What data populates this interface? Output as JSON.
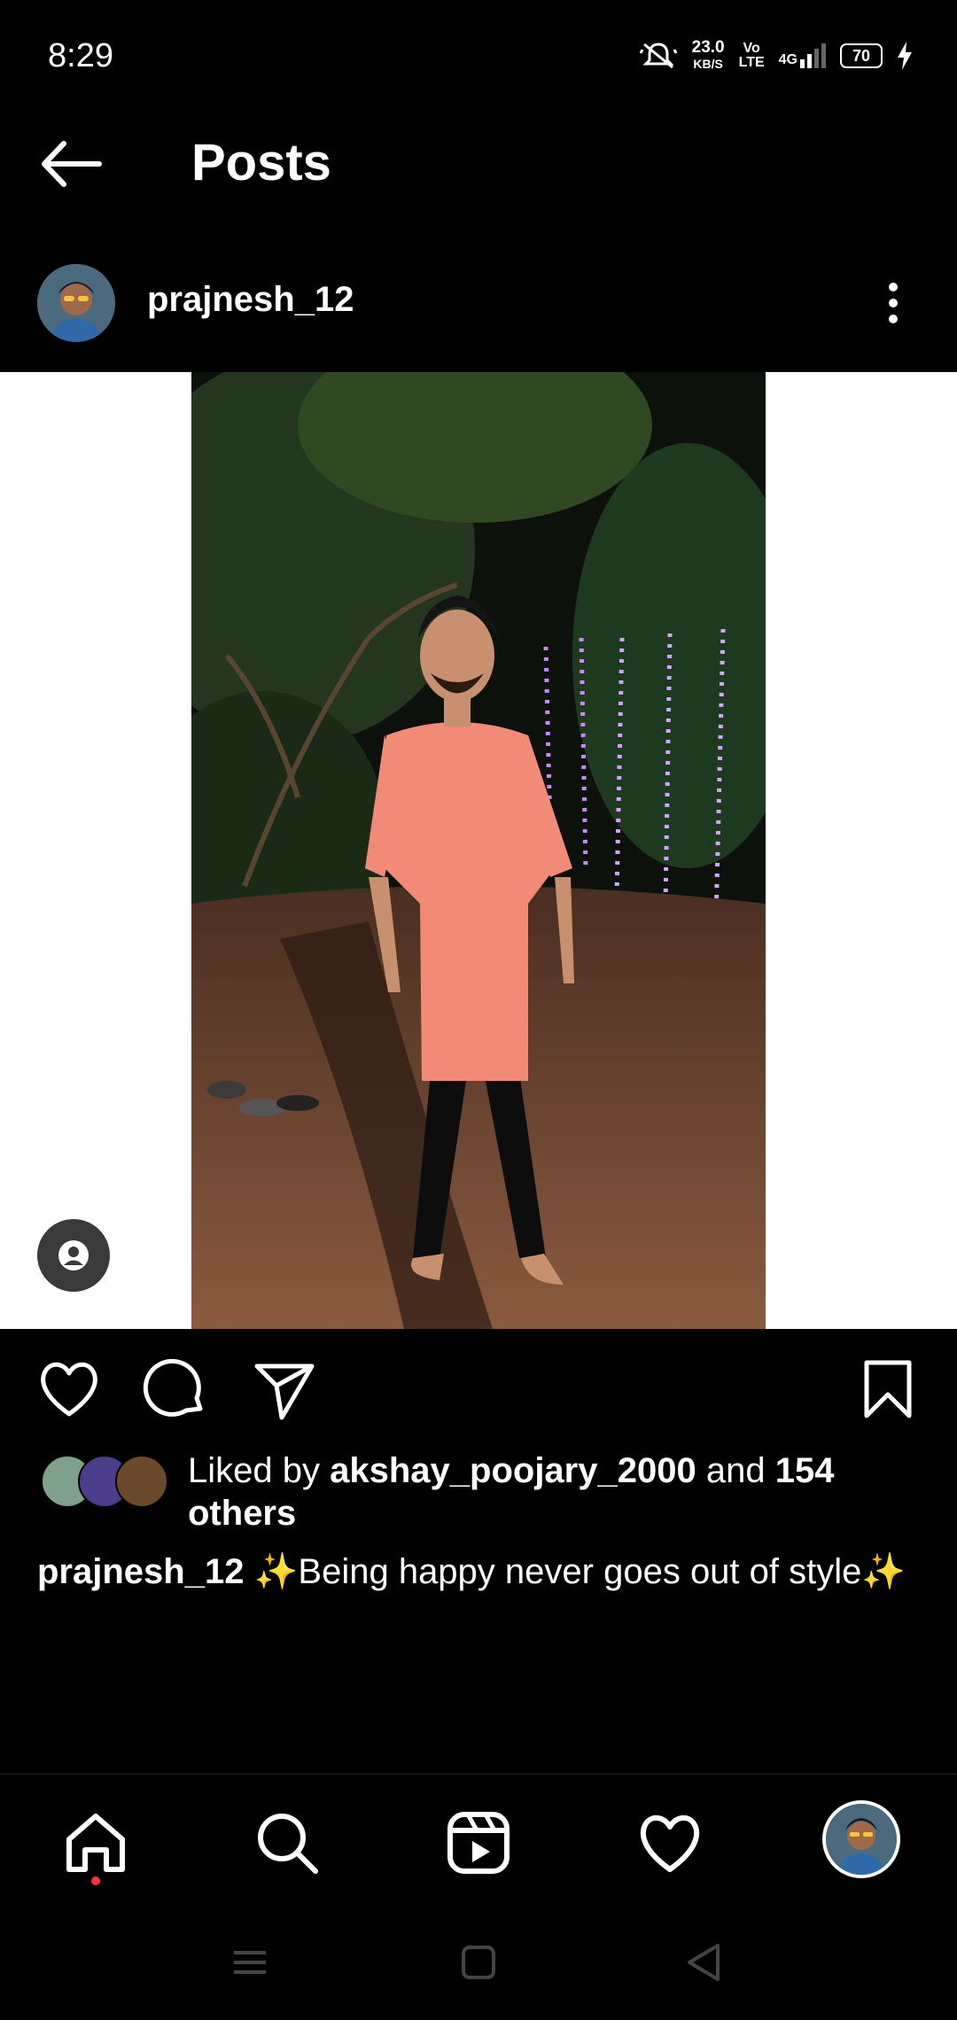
{
  "status_bar": {
    "time": "8:29",
    "net_speed_value": "23.0",
    "net_speed_unit": "KB/S",
    "volte_top": "Vo",
    "volte_bottom": "LTE",
    "network": "4G",
    "battery": "70"
  },
  "header": {
    "title": "Posts"
  },
  "post": {
    "username": "prajnesh_12",
    "likes": {
      "prefix": "Liked by ",
      "user": "akshay_poojary_2000",
      "middle": " and ",
      "count": "154",
      "suffix": "others"
    },
    "caption": {
      "user": "prajnesh_12",
      "text": "✨Being happy never goes out of style✨"
    }
  },
  "icons": {
    "back": "arrow-left-icon",
    "more": "more-vertical-icon",
    "tag": "person-tag-icon",
    "like": "heart-icon",
    "comment": "comment-icon",
    "share": "send-icon",
    "save": "bookmark-icon",
    "nav": [
      "home-icon",
      "search-icon",
      "reels-icon",
      "activity-heart-icon",
      "profile-avatar"
    ]
  },
  "colors": {
    "background": "#000000",
    "text": "#ffffff",
    "notification_dot": "#ff3040",
    "shirt": "#f28a78"
  }
}
